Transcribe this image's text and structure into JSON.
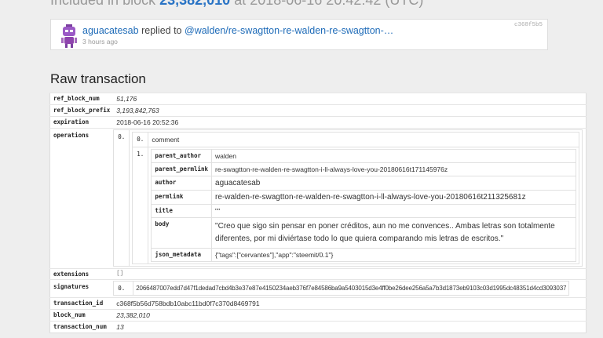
{
  "header": {
    "prefix": "Included in block",
    "block": "23,382,010",
    "suffix": "at 2018-06-16 20:42:42 (UTC)"
  },
  "op_card": {
    "author": "aguacatesab",
    "action": "replied to",
    "target": "@walden/re-swagtton-re-walden-re-swagtton-…",
    "time": "3 hours ago",
    "hash": "c368f5b5"
  },
  "section_title": "Raw transaction",
  "tx": {
    "ref_block_num": {
      "key": "ref_block_num",
      "value": "51,176"
    },
    "ref_block_prefix": {
      "key": "ref_block_prefix",
      "value": "3,193,842,763"
    },
    "expiration": {
      "key": "expiration",
      "value": "2018-06-16 20:52:36"
    },
    "operations": {
      "key": "operations",
      "op_index": "0.",
      "type_index": "0.",
      "type": "comment",
      "fields_index": "1.",
      "fields": {
        "parent_author": {
          "key": "parent_author",
          "value": "walden"
        },
        "parent_permlink": {
          "key": "parent_permlink",
          "value": "re-swagtton-re-walden-re-swagtton-i-ll-always-love-you-20180616t171145976z"
        },
        "author": {
          "key": "author",
          "value": "aguacatesab"
        },
        "permlink": {
          "key": "permlink",
          "value": "re-walden-re-swagtton-re-walden-re-swagtton-i-ll-always-love-you-20180616t211325681z"
        },
        "title": {
          "key": "title",
          "value": "\"\""
        },
        "body": {
          "key": "body",
          "value": "\"Creo que sigo sin pensar en poner créditos, aun no me convences.. Ambas letras son totalmente diferentes, por mi diviértase todo lo que quiera comparando mis letras de escritos.\""
        },
        "json_metadata": {
          "key": "json_metadata",
          "value": "{\"tags\":[\"cervantes\"],\"app\":\"steemit/0.1\"}"
        }
      }
    },
    "extensions": {
      "key": "extensions",
      "value": "[]"
    },
    "signatures": {
      "key": "signatures",
      "index": "0.",
      "value": "2066487007edd7d47f1dedad7cbd4b3e37e87e4150234aeb376f7e84586ba9a5403015d3e4ff0be26dee256a5a7b3d1873eb9103c03d1995dc48351d4cd3093037"
    },
    "transaction_id": {
      "key": "transaction_id",
      "value": "c368f5b56d758bdb10abc11bd0f7c370d8469791"
    },
    "block_num": {
      "key": "block_num",
      "value": "23,382,010"
    },
    "transaction_num": {
      "key": "transaction_num",
      "value": "13"
    }
  }
}
